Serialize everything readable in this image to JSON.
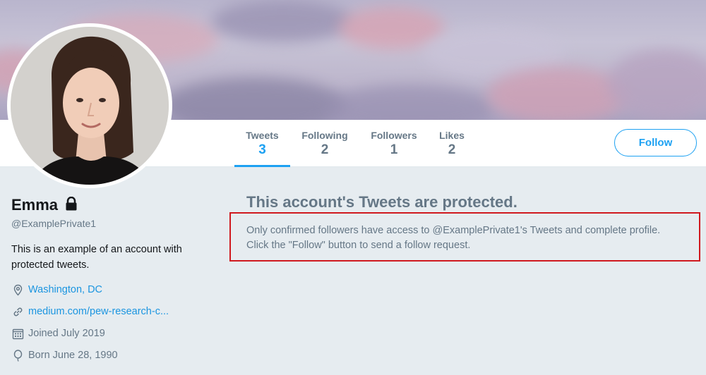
{
  "profile": {
    "name": "Emma",
    "handle": "@ExamplePrivate1",
    "bio": "This is an example of an account with protected tweets.",
    "location": "Washington, DC",
    "website": "medium.com/pew-research-c...",
    "joined": "Joined July 2019",
    "born": "Born June 28, 1990",
    "icons": [
      "lock-icon",
      "location-pin-icon",
      "link-icon",
      "calendar-icon",
      "balloon-icon"
    ]
  },
  "stats": [
    {
      "label": "Tweets",
      "value": "3"
    },
    {
      "label": "Following",
      "value": "2"
    },
    {
      "label": "Followers",
      "value": "1"
    },
    {
      "label": "Likes",
      "value": "2"
    }
  ],
  "actions": {
    "follow_label": "Follow"
  },
  "protected": {
    "title": "This account's Tweets are protected.",
    "line1": "Only confirmed followers have access to @ExamplePrivate1's Tweets and complete profile.",
    "line2": "Click the \"Follow\" button to send a follow request."
  },
  "colors": {
    "accent": "#1da1f2",
    "link": "#1b95e0",
    "highlight_border": "#d0191f",
    "muted": "#657786"
  }
}
